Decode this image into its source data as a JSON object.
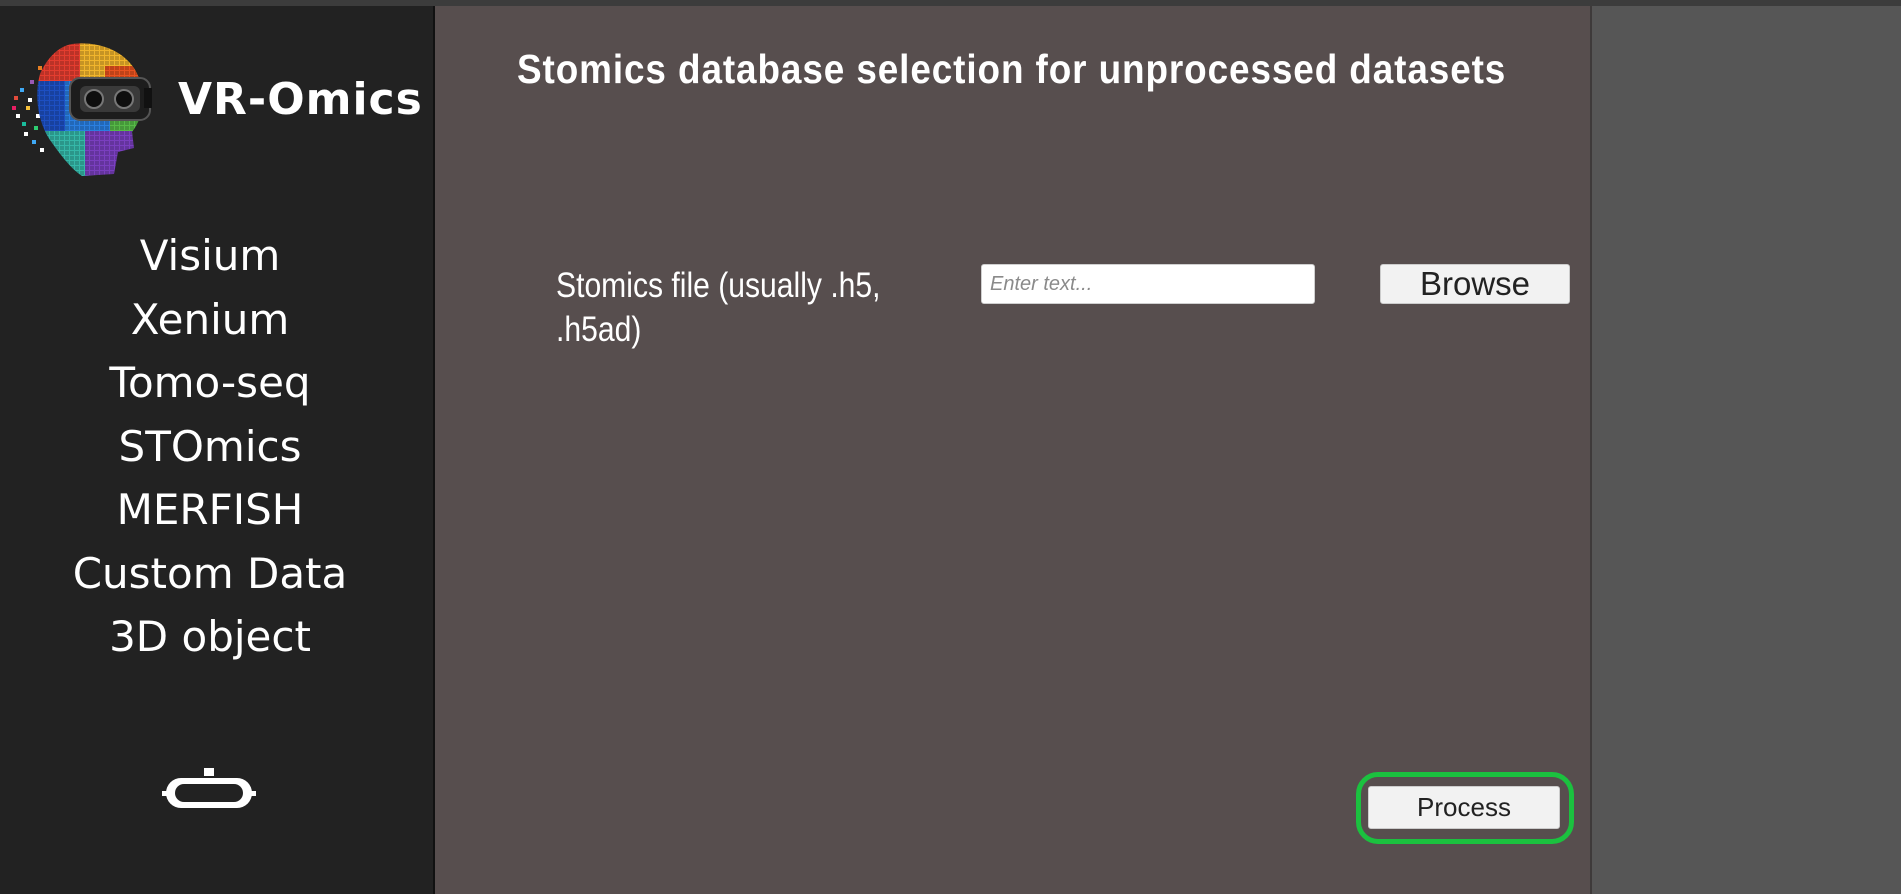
{
  "app": {
    "brand": "VR-Omics"
  },
  "sidebar": {
    "items": [
      {
        "label": "Visium"
      },
      {
        "label": "Xenium"
      },
      {
        "label": "Tomo-seq"
      },
      {
        "label": "STOmics"
      },
      {
        "label": "MERFISH"
      },
      {
        "label": "Custom Data"
      },
      {
        "label": "3D object"
      }
    ],
    "vr_icon": "vr-headset-icon"
  },
  "main": {
    "title": "Stomics database selection for unprocessed datasets",
    "file_label": "Stomics file (usually .h5, .h5ad)",
    "file_input": {
      "value": "",
      "placeholder": "Enter text..."
    },
    "browse_label": "Browse",
    "process_label": "Process"
  },
  "colors": {
    "sidebar_bg": "#222222",
    "main_bg": "#574e4e",
    "highlight_ring": "#1bc13f",
    "button_bg": "#f2f2f2"
  }
}
